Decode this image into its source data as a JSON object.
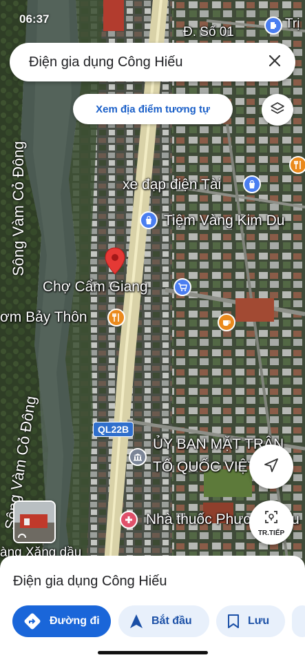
{
  "status_bar": {
    "time": "06:37"
  },
  "search": {
    "query": "Điện gia dụng Công Hiếu"
  },
  "similar_chip": {
    "label": "Xem địa điểm tương tự"
  },
  "map": {
    "street_top": "Đ. Số 01",
    "top_right_label": "Trị",
    "river_1": "Sông Vàm Cỏ Đông",
    "river_2": "Sông Vàm Cỏ Đông",
    "road_shield": "QL22B",
    "road_shield_top": "QL22B",
    "pois": [
      {
        "label": "xe đạp điện Tài",
        "kind": "shop"
      },
      {
        "label": "Tiệm Vàng Kim Du",
        "kind": "shop"
      },
      {
        "label": "Chợ Cẩm Giang",
        "kind": "market"
      },
      {
        "label": "ơm Bảy Thôn",
        "kind": "restaurant"
      },
      {
        "label": "ỦY BAN MẶT TRẬN",
        "kind": "government"
      },
      {
        "label": "TỔ QUỐC VIỆT NAM",
        "kind": "government"
      },
      {
        "label": "Nhà thuốc Phương Đậu",
        "kind": "pharmacy"
      },
      {
        "label": "àng Xăng dầu",
        "kind": "gas"
      }
    ]
  },
  "controls": {
    "layers_icon": "layers-icon",
    "directions_nav_icon": "navigation-arrow-icon",
    "streetview_label": "TR.TIẾP"
  },
  "sheet": {
    "place_name": "Điện gia dụng Công Hiếu",
    "actions": [
      {
        "label": "Đường đi",
        "icon": "directions-icon"
      },
      {
        "label": "Bắt đầu",
        "icon": "navigation-icon"
      },
      {
        "label": "Lưu",
        "icon": "bookmark-icon"
      }
    ]
  },
  "colors": {
    "accent": "#1a66d9",
    "chip_text": "#1a5fc8",
    "pin": "#e53935"
  }
}
